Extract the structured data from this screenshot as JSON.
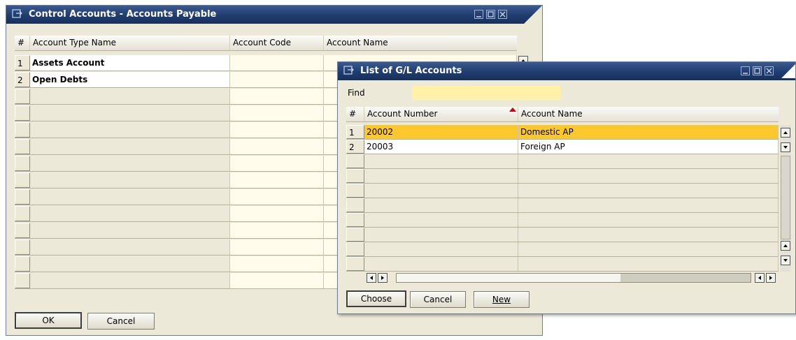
{
  "control_window": {
    "title": "Control Accounts - Accounts Payable",
    "columns": [
      "#",
      "Account Type Name",
      "Account Code",
      "Account Name"
    ],
    "rows": [
      {
        "num": "1",
        "type": "Assets Account",
        "code": "",
        "name": ""
      },
      {
        "num": "2",
        "type": "Open Debts",
        "code": "",
        "name": ""
      },
      {
        "num": "",
        "type": "",
        "code": "",
        "name": ""
      },
      {
        "num": "",
        "type": "",
        "code": "",
        "name": ""
      },
      {
        "num": "",
        "type": "",
        "code": "",
        "name": ""
      },
      {
        "num": "",
        "type": "",
        "code": "",
        "name": ""
      },
      {
        "num": "",
        "type": "",
        "code": "",
        "name": ""
      },
      {
        "num": "",
        "type": "",
        "code": "",
        "name": ""
      },
      {
        "num": "",
        "type": "",
        "code": "",
        "name": ""
      },
      {
        "num": "",
        "type": "",
        "code": "",
        "name": ""
      },
      {
        "num": "",
        "type": "",
        "code": "",
        "name": ""
      },
      {
        "num": "",
        "type": "",
        "code": "",
        "name": ""
      },
      {
        "num": "",
        "type": "",
        "code": "",
        "name": ""
      },
      {
        "num": "",
        "type": "",
        "code": "",
        "name": ""
      }
    ],
    "buttons": {
      "ok": "OK",
      "cancel": "Cancel"
    }
  },
  "gl_window": {
    "title": "List of G/L Accounts",
    "find_label": "Find",
    "find_value": "",
    "columns": [
      "#",
      "Account Number",
      "Account Name"
    ],
    "rows": [
      {
        "num": "1",
        "number": "20002",
        "name": "Domestic AP",
        "selected": true
      },
      {
        "num": "2",
        "number": "20003",
        "name": "Foreign AP",
        "selected": false
      },
      {
        "num": "",
        "number": "",
        "name": "",
        "selected": false
      },
      {
        "num": "",
        "number": "",
        "name": "",
        "selected": false
      },
      {
        "num": "",
        "number": "",
        "name": "",
        "selected": false
      },
      {
        "num": "",
        "number": "",
        "name": "",
        "selected": false
      },
      {
        "num": "",
        "number": "",
        "name": "",
        "selected": false
      },
      {
        "num": "",
        "number": "",
        "name": "",
        "selected": false
      },
      {
        "num": "",
        "number": "",
        "name": "",
        "selected": false
      },
      {
        "num": "",
        "number": "",
        "name": "",
        "selected": false
      }
    ],
    "buttons": {
      "choose": "Choose",
      "cancel": "Cancel",
      "new": "New"
    }
  },
  "colors": {
    "title_bar": "#1f3c6e",
    "window_bg": "#ece9d8",
    "editable_cell": "#fffcec",
    "selected_row": "#fdc82e",
    "find_field": "#fff2a8",
    "sort_indicator": "#c00000"
  },
  "icons": [
    "window-icon",
    "minimize-icon",
    "maximize-icon",
    "close-icon",
    "sort-ascending-icon",
    "scroll-up-icon",
    "scroll-down-icon",
    "scroll-left-icon",
    "scroll-right-icon"
  ]
}
